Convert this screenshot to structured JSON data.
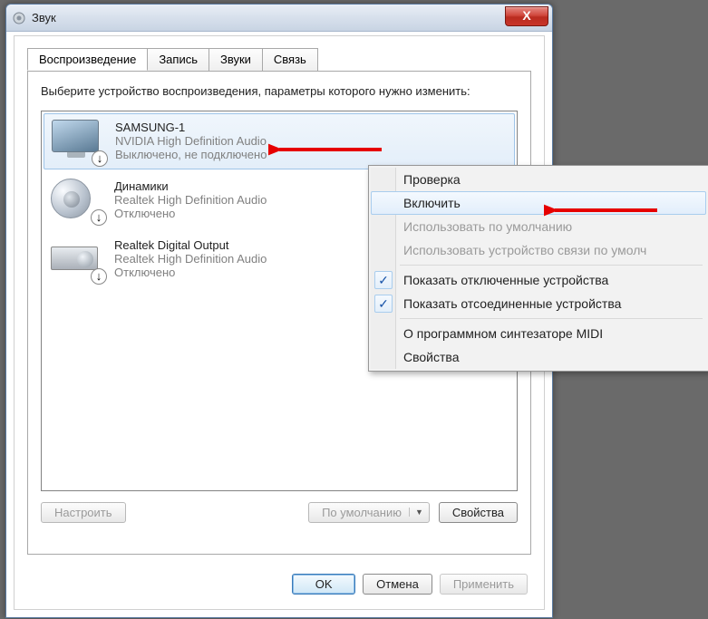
{
  "window": {
    "title": "Звук",
    "close_label": "X"
  },
  "tabs": {
    "playback": "Воспроизведение",
    "recording": "Запись",
    "sounds": "Звуки",
    "comm": "Связь"
  },
  "instruction": "Выберите устройство воспроизведения, параметры которого нужно изменить:",
  "devices": [
    {
      "name": "SAMSUNG-1",
      "controller": "NVIDIA High Definition Audio",
      "status": "Выключено, не подключено",
      "icon": "monitor",
      "selected": true
    },
    {
      "name": "Динамики",
      "controller": "Realtek High Definition Audio",
      "status": "Отключено",
      "icon": "speaker",
      "selected": false
    },
    {
      "name": "Realtek Digital Output",
      "controller": "Realtek High Definition Audio",
      "status": "Отключено",
      "icon": "box",
      "selected": false
    }
  ],
  "panel_buttons": {
    "configure": "Настроить",
    "default": "По умолчанию",
    "properties": "Свойства"
  },
  "dialog_buttons": {
    "ok": "OK",
    "cancel": "Отмена",
    "apply": "Применить"
  },
  "context_menu": {
    "test": "Проверка",
    "enable": "Включить",
    "set_default": "Использовать по умолчанию",
    "set_default_comm": "Использовать устройство связи по умолч",
    "show_disabled": "Показать отключенные устройства",
    "show_disconnected": "Показать отсоединенные устройства",
    "about_midi": "О программном синтезаторе MIDI",
    "properties": "Свойства"
  }
}
